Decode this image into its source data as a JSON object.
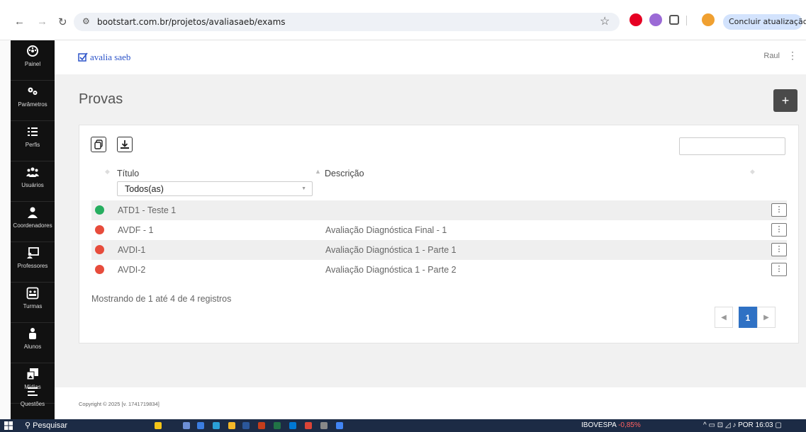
{
  "browser": {
    "url": "bootstart.com.br/projetos/avaliasaeb/exams",
    "update_label": "Concluir atualização",
    "update_menu": "⋮"
  },
  "sidebar": {
    "items": [
      {
        "label": "Painel",
        "icon": "dashboard-icon"
      },
      {
        "label": "Parâmetros",
        "icon": "gears-icon"
      },
      {
        "label": "Perfis",
        "icon": "list-icon"
      },
      {
        "label": "Usuários",
        "icon": "users-icon"
      },
      {
        "label": "Coordenadores",
        "icon": "coordinator-icon"
      },
      {
        "label": "Professores",
        "icon": "teacher-icon"
      },
      {
        "label": "Turmas",
        "icon": "classes-icon"
      },
      {
        "label": "Alunos",
        "icon": "students-icon"
      },
      {
        "label": "Mídias",
        "icon": "media-icon"
      },
      {
        "label": "Questões",
        "icon": "questions-icon"
      }
    ]
  },
  "header": {
    "brand": "avalia saeb",
    "user": "Raul"
  },
  "page": {
    "title": "Provas",
    "add_label": "+"
  },
  "table": {
    "columns": [
      "Título",
      "Descrição"
    ],
    "filter_value": "Todos(as)",
    "rows": [
      {
        "status": "green",
        "title": "ATD1 - Teste 1",
        "description": ""
      },
      {
        "status": "red",
        "title": "AVDF - 1",
        "description": "Avaliação Diagnóstica Final - 1"
      },
      {
        "status": "red",
        "title": "AVDI-1",
        "description": "Avaliação Diagnóstica 1 - Parte 1"
      },
      {
        "status": "red",
        "title": "AVDI-2",
        "description": "Avaliação Diagnóstica 1 - Parte 2"
      }
    ],
    "info": "Mostrando de 1 até 4 de 4 registros",
    "current_page": "1"
  },
  "footer": {
    "copyright": "Copyright © 2025 [v. 1741719834]"
  },
  "taskbar": {
    "search": "Pesquisar",
    "stock_name": "IBOVESPA",
    "stock_change": "-0,85%",
    "lang": "POR",
    "time": "16:03"
  },
  "colors": {
    "status_green": "#27ae60",
    "status_red": "#e74c3c",
    "accent": "#2f71c4",
    "sidebar": "#111111"
  }
}
